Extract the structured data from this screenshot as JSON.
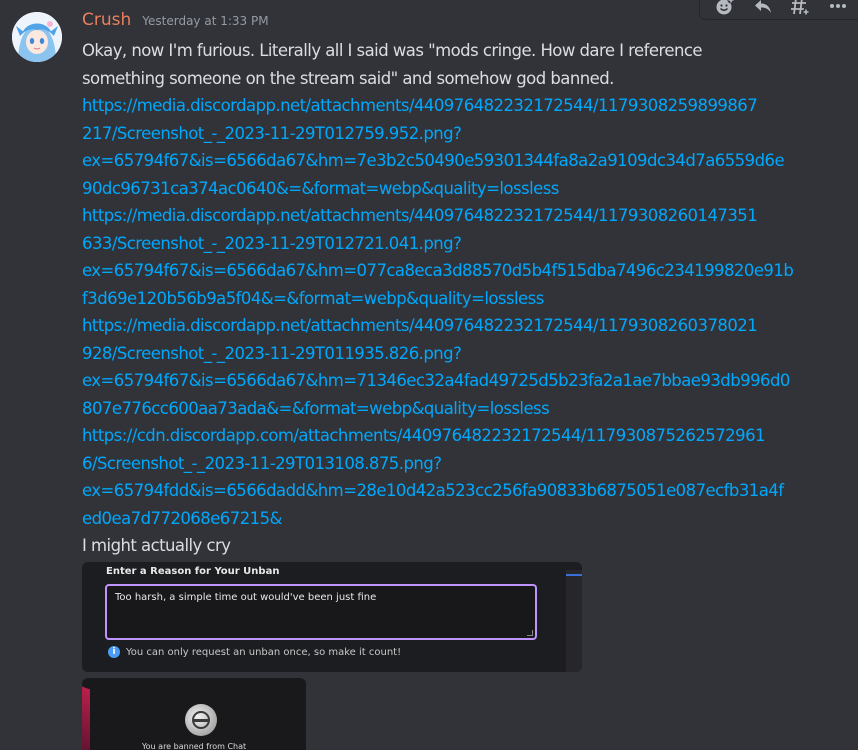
{
  "message": {
    "username": "Crush",
    "timestamp": "Yesterday at 1:33 PM",
    "text_lines": [
      "Okay, now I'm furious. Literally all I said was \"mods cringe. How dare I reference",
      "something someone on the stream said\" and somehow god banned."
    ],
    "links": [
      [
        "https://media.discordapp.net/attachments/440976482232172544/1179308259899867",
        "217/Screenshot_-_2023-11-29T012759.952.png?",
        "ex=65794f67&is=6566da67&hm=7e3b2c50490e59301344fa8a2a9109dc34d7a6559d6e",
        "90dc96731ca374ac0640&=&format=webp&quality=lossless"
      ],
      [
        "https://media.discordapp.net/attachments/440976482232172544/1179308260147351",
        "633/Screenshot_-_2023-11-29T012721.041.png?",
        "ex=65794f67&is=6566da67&hm=077ca8eca3d88570d5b4f515dba7496c234199820e91b",
        "f3d69e120b56b9a5f04&=&format=webp&quality=lossless"
      ],
      [
        "https://media.discordapp.net/attachments/440976482232172544/1179308260378021",
        "928/Screenshot_-_2023-11-29T011935.826.png?",
        "ex=65794f67&is=6566da67&hm=71346ec32a4fad49725d5b23fa2a1ae7bbae93db996d0",
        "807e776cc600aa73ada&=&format=webp&quality=lossless"
      ],
      [
        "https://cdn.discordapp.com/attachments/440976482232172544/117930875262572961",
        "6/Screenshot_-_2023-11-29T013108.875.png?",
        "ex=65794fdd&is=6566dadd&hm=28e10d42a523cc256fa90833b6875051e087ecfb31a4f",
        "ed0ea7d772068e67215&"
      ]
    ],
    "final_line": "I might actually cry"
  },
  "attachments": {
    "unban_form": {
      "title": "Enter a Reason for Your Unban",
      "input_value": "Too harsh, a simple time out would've been just fine",
      "info": "You can only request an unban once, so make it count!"
    },
    "banned_screen": {
      "text": "You are banned from Chat"
    }
  },
  "hover_bar": {
    "icons": [
      "add-reaction-icon",
      "reply-icon",
      "create-thread-icon",
      "more-icon"
    ]
  },
  "colors": {
    "background": "#323339",
    "username": "#e87f5e",
    "link": "#00a8fc",
    "text": "#dbdee1",
    "timestamp": "#949ba4"
  }
}
